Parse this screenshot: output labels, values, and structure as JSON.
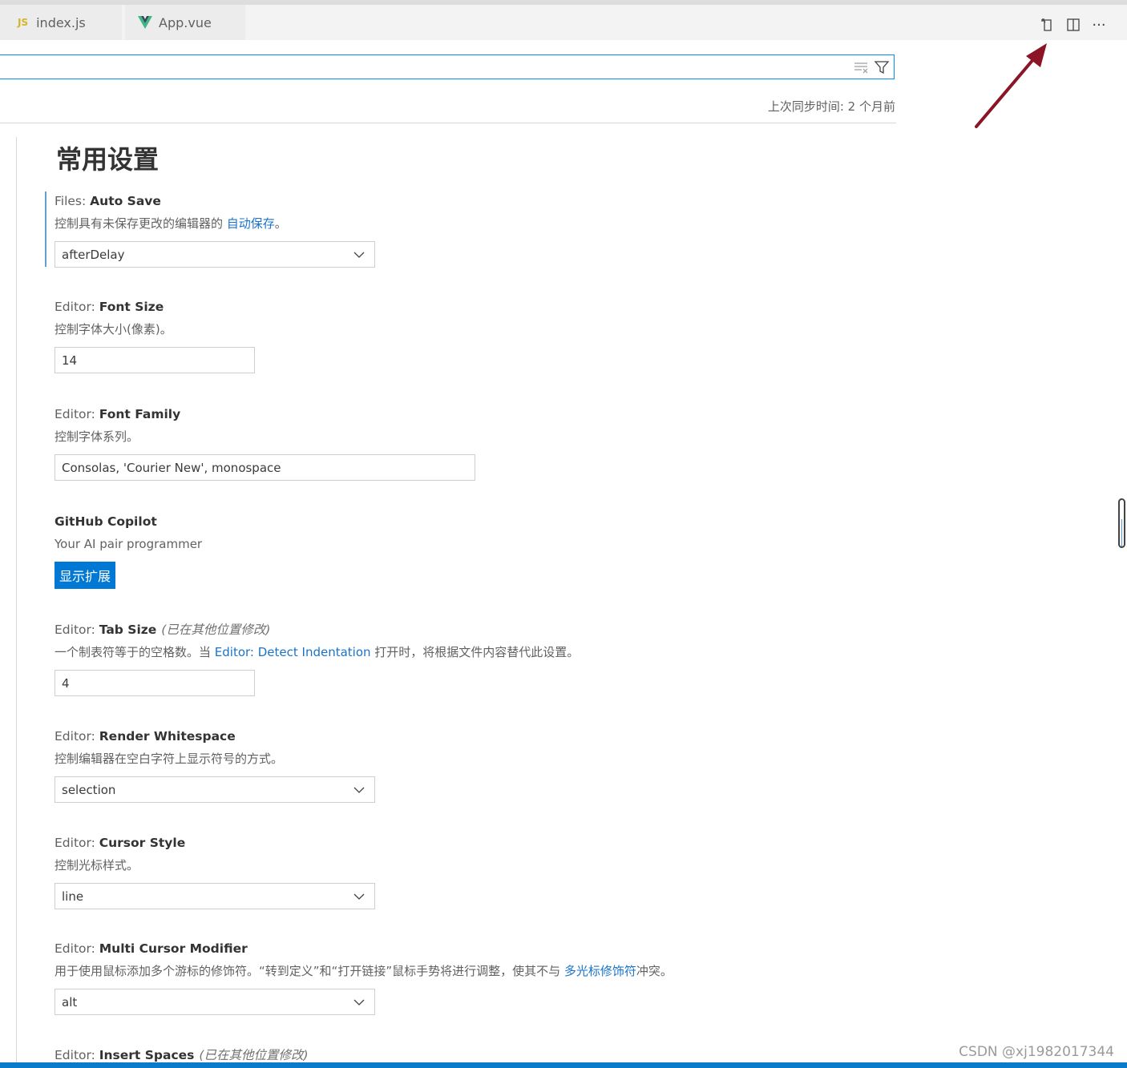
{
  "tabs": [
    {
      "label": "index.js",
      "icon": "js-file-icon"
    },
    {
      "label": "App.vue",
      "icon": "vue-file-icon"
    }
  ],
  "editor_actions": {
    "open_json_icon": "open-settings-json-icon",
    "split_icon": "split-editor-icon",
    "more_label": "···"
  },
  "search": {
    "value": "",
    "placeholder": ""
  },
  "sync_text": "上次同步时间: 2 个月前",
  "heading": "常用设置",
  "settings": {
    "auto_save": {
      "category": "Files: ",
      "name": "Auto Save",
      "desc_before": "控制具有未保存更改的编辑器的 ",
      "desc_link": "自动保存",
      "desc_after": "。",
      "value": "afterDelay"
    },
    "font_size": {
      "category": "Editor: ",
      "name": "Font Size",
      "desc": "控制字体大小(像素)。",
      "value": "14"
    },
    "font_family": {
      "category": "Editor: ",
      "name": "Font Family",
      "desc": "控制字体系列。",
      "value": "Consolas, 'Courier New', monospace"
    },
    "copilot": {
      "name": "GitHub Copilot",
      "desc": "Your AI pair programmer",
      "button": "显示扩展"
    },
    "tab_size": {
      "category": "Editor: ",
      "name": "Tab Size",
      "modified": "(已在其他位置修改)",
      "desc_before": "一个制表符等于的空格数。当 ",
      "desc_link": "Editor: Detect Indentation",
      "desc_after": " 打开时，将根据文件内容替代此设置。",
      "value": "4"
    },
    "render_whitespace": {
      "category": "Editor: ",
      "name": "Render Whitespace",
      "desc": "控制编辑器在空白字符上显示符号的方式。",
      "value": "selection"
    },
    "cursor_style": {
      "category": "Editor: ",
      "name": "Cursor Style",
      "desc": "控制光标样式。",
      "value": "line"
    },
    "multi_cursor": {
      "category": "Editor: ",
      "name": "Multi Cursor Modifier",
      "desc_before": "用于使用鼠标添加多个游标的修饰符。“转到定义”和“打开链接”鼠标手势将进行调整，使其不与 ",
      "desc_link": "多光标修饰符",
      "desc_after": "冲突。",
      "value": "alt"
    },
    "insert_spaces": {
      "category": "Editor: ",
      "name": "Insert Spaces",
      "modified": "(已在其他位置修改)"
    }
  },
  "watermark": "CSDN @xj1982017344",
  "colors": {
    "accent": "#0078d4",
    "link": "#1a73c8",
    "annotation_arrow": "#8b1426",
    "focus_border": "#0090f1"
  }
}
